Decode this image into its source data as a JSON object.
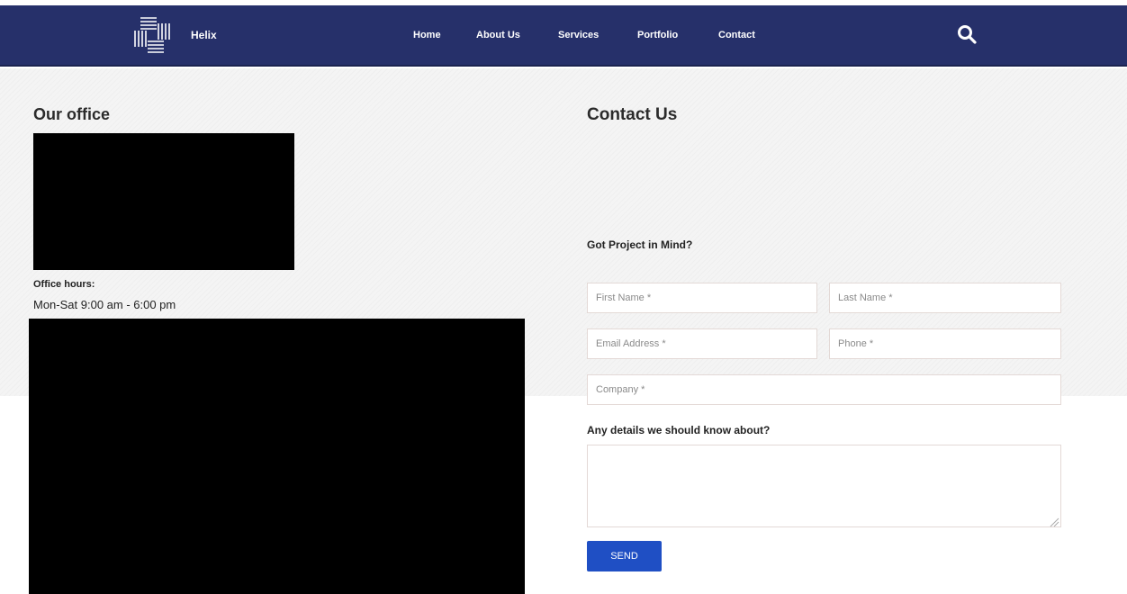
{
  "brand": {
    "name": "Helix",
    "logo_icon": "helix-logo-icon"
  },
  "nav": {
    "items": [
      {
        "label": "Home"
      },
      {
        "label": "About Us"
      },
      {
        "label": "Services"
      },
      {
        "label": "Portfolio"
      },
      {
        "label": "Contact"
      }
    ],
    "search_icon": "search-icon"
  },
  "office": {
    "heading": "Our office",
    "hours_label": "Office hours:",
    "hours_value": "Mon-Sat 9:00 am - 6:00 pm"
  },
  "contact": {
    "heading": "Contact Us",
    "subheading": "Got Project in Mind?",
    "fields": {
      "first_name": {
        "placeholder": "First Name *",
        "value": ""
      },
      "last_name": {
        "placeholder": "Last Name *",
        "value": ""
      },
      "email": {
        "placeholder": "Email Address *",
        "value": ""
      },
      "phone": {
        "placeholder": "Phone *",
        "value": ""
      },
      "company": {
        "placeholder": "Company *",
        "value": ""
      }
    },
    "details_label": "Any details we should know about?",
    "details_value": "",
    "send_label": "SEND"
  },
  "colors": {
    "navbar": "#26306a",
    "accent_button": "#1f4fc4",
    "background": "#f4f4f4"
  }
}
